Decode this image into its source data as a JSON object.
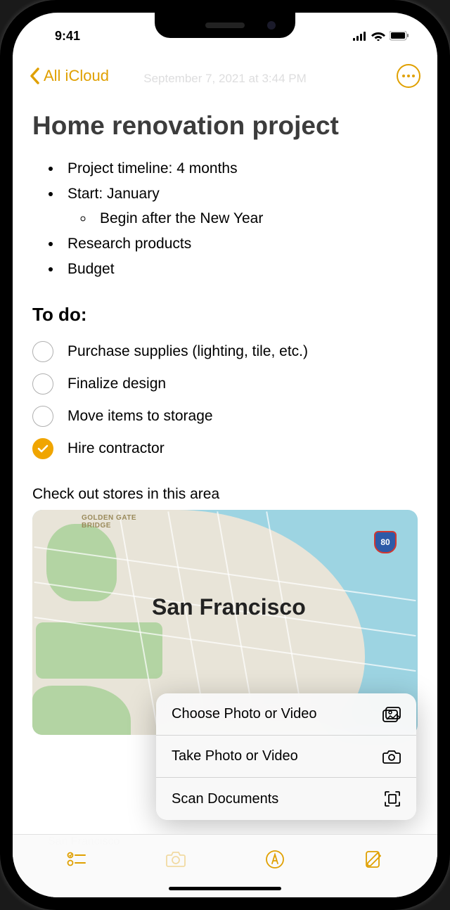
{
  "status": {
    "time": "9:41"
  },
  "nav": {
    "back_label": "All iCloud",
    "faded_date": "September 7, 2021 at 3:44 PM"
  },
  "note": {
    "title": "Home renovation project",
    "bullets": [
      "Project timeline: 4 months",
      "Start: January",
      "Research products",
      "Budget"
    ],
    "sub_bullet": "Begin after the New Year",
    "todo_heading": "To do:",
    "checklist": [
      {
        "label": "Purchase supplies (lighting, tile, etc.)",
        "checked": false
      },
      {
        "label": "Finalize design",
        "checked": false
      },
      {
        "label": "Move items to storage",
        "checked": false
      },
      {
        "label": "Hire contractor",
        "checked": true
      }
    ],
    "map_caption": "Check out stores in this area"
  },
  "map": {
    "city_label": "San Francisco",
    "bridge_label": "GOLDEN GATE\nBRIDGE",
    "highway": "80",
    "faded_caption": "San Francisco"
  },
  "menu": {
    "items": [
      {
        "label": "Choose Photo or Video",
        "icon": "photo-library-icon"
      },
      {
        "label": "Take Photo or Video",
        "icon": "camera-icon"
      },
      {
        "label": "Scan Documents",
        "icon": "scan-icon"
      }
    ]
  }
}
